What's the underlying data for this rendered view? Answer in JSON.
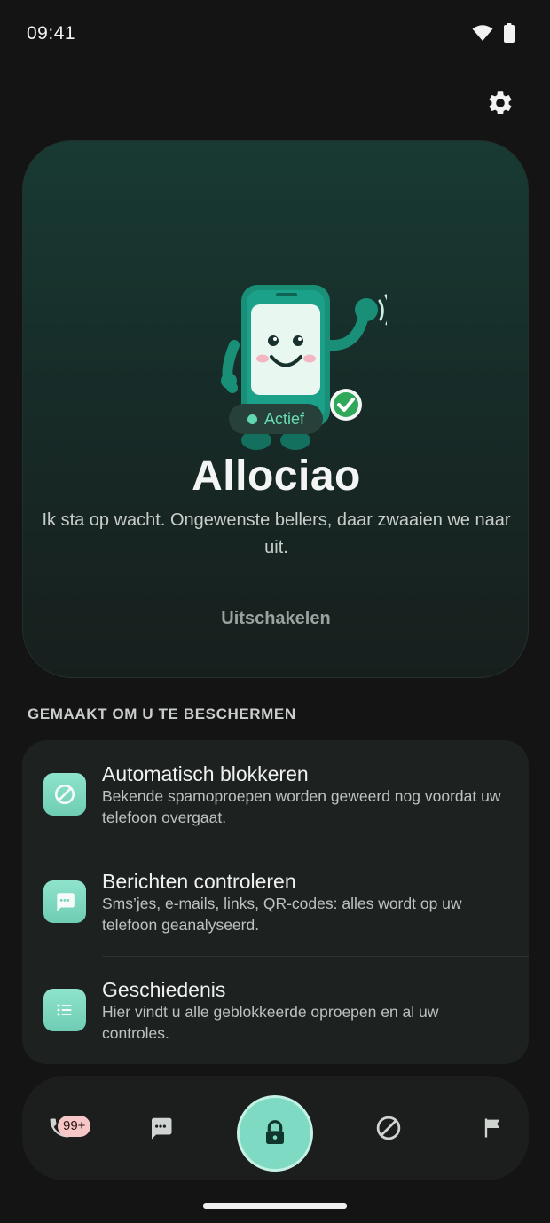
{
  "status_bar": {
    "time": "09:41"
  },
  "header": {
    "settings_icon": "gear-icon"
  },
  "hero": {
    "status_label": "Actief",
    "title": "Allociao",
    "subtitle": "Ik sta op wacht. Ongewenste bellers, daar zwaaien we naar uit.",
    "action_label": "Uitschakelen"
  },
  "section": {
    "title": "GEMAAKT OM U TE BESCHERMEN"
  },
  "features": [
    {
      "icon": "block-icon",
      "title": "Automatisch blokkeren",
      "description": "Bekende spamoproepen worden geweerd nog voordat uw telefoon overgaat."
    },
    {
      "icon": "message-icon",
      "title": "Berichten controleren",
      "description": "Sms’jes, e-mails, links, QR-codes: alles wordt op uw telefoon geanalyseerd."
    },
    {
      "icon": "list-icon",
      "title": "Geschiedenis",
      "description": "Hier vindt u alle geblokkeerde oproepen en al uw controles."
    }
  ],
  "bottom_nav": {
    "calls_badge": "99+",
    "items": [
      "phone-icon",
      "message-icon",
      "lock-icon",
      "block-icon",
      "flag-icon"
    ]
  },
  "colors": {
    "accent": "#7fdac3",
    "active": "#5fd8b0",
    "background": "#141414"
  }
}
